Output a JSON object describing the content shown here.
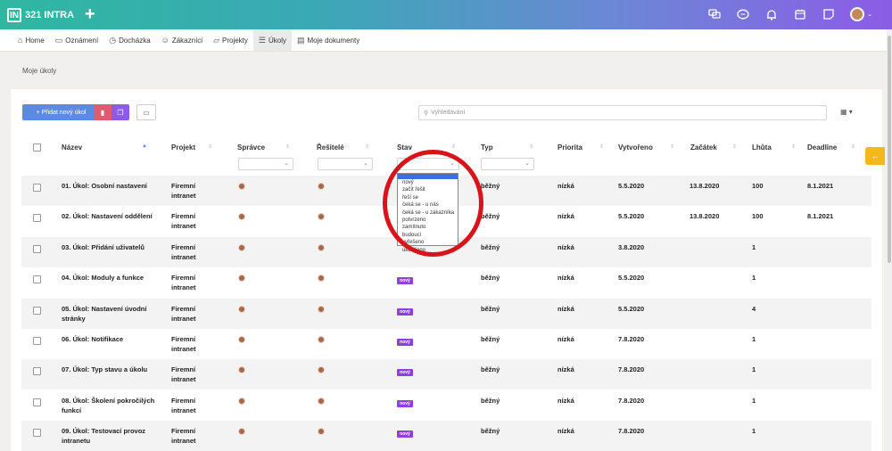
{
  "app": {
    "logo_letter": "IN",
    "logo_text": "321 INTRA",
    "new_label": "+"
  },
  "topbar_icons": [
    "chat-icon",
    "message-icon",
    "bell-icon",
    "calendar-icon",
    "note-icon",
    "avatar-menu"
  ],
  "nav": [
    {
      "label": "Home",
      "icon": "home-icon"
    },
    {
      "label": "Oznámení",
      "icon": "announcement-icon"
    },
    {
      "label": "Docházka",
      "icon": "clock-icon"
    },
    {
      "label": "Zákazníci",
      "icon": "user-icon"
    },
    {
      "label": "Projekty",
      "icon": "folder-icon"
    },
    {
      "label": "Úkoly",
      "icon": "tasks-icon",
      "active": true
    },
    {
      "label": "Moje dokumenty",
      "icon": "document-icon"
    }
  ],
  "breadcrumb": "Moje úkoly",
  "toolbar": {
    "add_label": "+ Přidat nový úkol",
    "search_placeholder": "Vyhledávání"
  },
  "columns": [
    "Název",
    "Projekt",
    "Správce",
    "Řešitelé",
    "Stav",
    "Typ",
    "Priorita",
    "Vytvořeno",
    "Začátek",
    "Lhůta",
    "Deadline"
  ],
  "status_options": [
    "nový",
    "začít řešit",
    "řeší se",
    "čeká se - u nás",
    "čeká se - u zákazníka",
    "potvrzeno",
    "zamítnuto",
    "budoucí",
    "vyřešeno",
    "ukončeno"
  ],
  "rows": [
    {
      "name1": "01. Úkol: Osobní nastavení",
      "name2": "",
      "proj1": "Firemní",
      "proj2": "intranet",
      "stav": "",
      "typ": "běžný",
      "priorita": "nízká",
      "vytvoreno": "5.5.2020",
      "zacatek": "13.8.2020",
      "lhuta": "100",
      "deadline": "8.1.2021"
    },
    {
      "name1": "02. Úkol: Nastavení oddělení",
      "name2": "",
      "proj1": "Firemní",
      "proj2": "intranet",
      "stav": "",
      "typ": "běžný",
      "priorita": "nízká",
      "vytvoreno": "5.5.2020",
      "zacatek": "13.8.2020",
      "lhuta": "100",
      "deadline": "8.1.2021"
    },
    {
      "name1": "03. Úkol: Přidání uživatelů",
      "name2": "",
      "proj1": "Firemní",
      "proj2": "intranet",
      "stav": "",
      "typ": "běžný",
      "priorita": "nízká",
      "vytvoreno": "3.8.2020",
      "zacatek": "",
      "lhuta": "1",
      "deadline": ""
    },
    {
      "name1": "04. Úkol: Moduly a funkce",
      "name2": "",
      "proj1": "Firemní",
      "proj2": "intranet",
      "stav": "nový",
      "typ": "běžný",
      "priorita": "nízká",
      "vytvoreno": "5.5.2020",
      "zacatek": "",
      "lhuta": "1",
      "deadline": ""
    },
    {
      "name1": "05. Úkol: Nastavení úvodní",
      "name2": "stránky",
      "proj1": "Firemní",
      "proj2": "intranet",
      "stav": "nový",
      "typ": "běžný",
      "priorita": "nízká",
      "vytvoreno": "5.5.2020",
      "zacatek": "",
      "lhuta": "4",
      "deadline": ""
    },
    {
      "name1": "06. Úkol: Notifikace",
      "name2": "",
      "proj1": "Firemní",
      "proj2": "intranet",
      "stav": "nový",
      "typ": "běžný",
      "priorita": "nízká",
      "vytvoreno": "7.8.2020",
      "zacatek": "",
      "lhuta": "1",
      "deadline": ""
    },
    {
      "name1": "07. Úkol: Typ stavu a úkolu",
      "name2": "",
      "proj1": "Firemní",
      "proj2": "intranet",
      "stav": "nový",
      "typ": "běžný",
      "priorita": "nízká",
      "vytvoreno": "7.8.2020",
      "zacatek": "",
      "lhuta": "1",
      "deadline": ""
    },
    {
      "name1": "08. Úkol: Školení pokročilých",
      "name2": "funkcí",
      "proj1": "Firemní",
      "proj2": "intranet",
      "stav": "nový",
      "typ": "běžný",
      "priorita": "nízká",
      "vytvoreno": "7.8.2020",
      "zacatek": "",
      "lhuta": "1",
      "deadline": ""
    },
    {
      "name1": "09. Úkol: Testovací provoz",
      "name2": "intranetu",
      "proj1": "Firemní",
      "proj2": "intranet",
      "stav": "nový",
      "typ": "běžný",
      "priorita": "nízká",
      "vytvoreno": "7.8.2020",
      "zacatek": "",
      "lhuta": "1",
      "deadline": ""
    }
  ],
  "colors": {
    "accent": "#5b8be0",
    "badge": "#8d3fe0",
    "highlight_circle": "#d7141a",
    "sidetab": "#f2b81c"
  }
}
